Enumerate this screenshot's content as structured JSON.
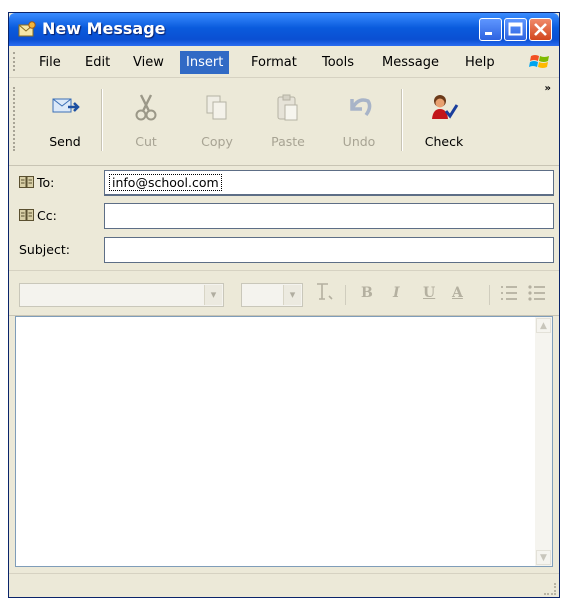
{
  "window": {
    "title": "New Message"
  },
  "menu": [
    "File",
    "Edit",
    "View",
    "Insert",
    "Format",
    "Tools",
    "Message",
    "Help"
  ],
  "menu_active": "Insert",
  "toolbar": {
    "send": "Send",
    "cut": "Cut",
    "copy": "Copy",
    "paste": "Paste",
    "undo": "Undo",
    "check": "Check"
  },
  "fields": {
    "to_label": "To:",
    "to_value": "info@school.com",
    "cc_label": "Cc:",
    "cc_value": "",
    "subject_label": "Subject:",
    "subject_value": ""
  },
  "format": {
    "bold": "B",
    "italic": "I",
    "underline": "U",
    "font_color": "A"
  },
  "colors": {
    "titlebar": "#0A5BDD",
    "menu_highlight": "#316AC5",
    "chrome": "#ECE9D8",
    "disabled_text": "#A7A393"
  },
  "icons": [
    "window-icon",
    "minimize-icon",
    "maximize-icon",
    "close-icon",
    "windows-logo-icon",
    "send-icon",
    "cut-icon",
    "copy-icon",
    "paste-icon",
    "undo-icon",
    "check-names-icon",
    "address-book-icon",
    "align-icon",
    "numbered-list-icon",
    "bulleted-list-icon"
  ]
}
